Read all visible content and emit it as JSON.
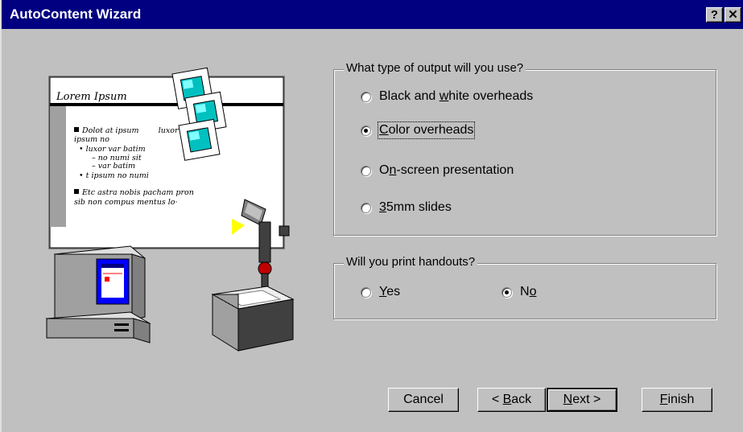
{
  "window": {
    "title": "AutoContent Wizard",
    "help_label": "?",
    "close_label": "✕"
  },
  "output_group": {
    "label": "What type of output will you use?",
    "options": [
      {
        "label_pre": "Black and ",
        "label_key": "w",
        "label_post": "hite overheads",
        "selected": false
      },
      {
        "label_pre": "",
        "label_key": "C",
        "label_post": "olor overheads",
        "selected": true
      },
      {
        "label_pre": "O",
        "label_key": "n",
        "label_post": "-screen presentation",
        "selected": false
      },
      {
        "label_pre": "",
        "label_key": "3",
        "label_post": "5mm slides",
        "selected": false
      }
    ]
  },
  "handouts_group": {
    "label": "Will you print handouts?",
    "yes": {
      "label_key": "Y",
      "label_post": "es",
      "selected": false
    },
    "no": {
      "label_pre": "N",
      "label_key": "o",
      "selected": true
    }
  },
  "buttons": {
    "cancel": "Cancel",
    "back": {
      "prefix": "< ",
      "key": "B",
      "rest": "ack"
    },
    "next": {
      "key": "N",
      "rest": "ext >"
    },
    "finish": {
      "key": "F",
      "rest": "inish"
    }
  },
  "illustration": {
    "slide_title": "Lorem Ipsum",
    "bullets": [
      "Dolot at ipsum        luxor var",
      "ipsum no",
      "• luxor var batim",
      "  – no numi sit",
      "  – var batim",
      "• t ipsum no numi",
      "Etc astra nobis pacham pron",
      "sib non compus mentus lo·"
    ]
  },
  "colors": {
    "titlebar": "#000080",
    "face": "#c0c0c0",
    "screen_blue": "#0000ff",
    "teal": "#008080"
  }
}
